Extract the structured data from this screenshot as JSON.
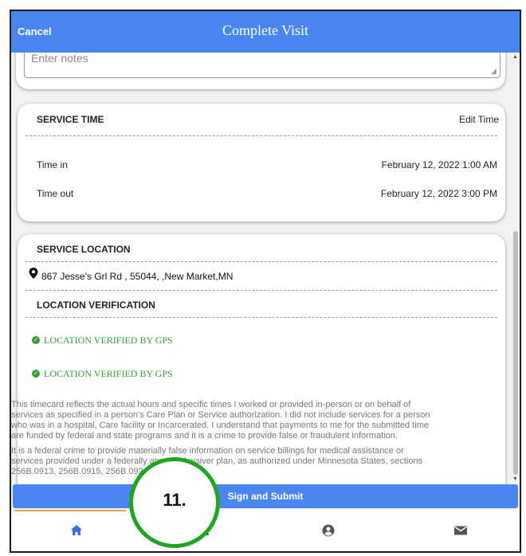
{
  "header": {
    "cancel_label": "Cancel",
    "title": "Complete Visit"
  },
  "notes": {
    "placeholder": "Enter notes"
  },
  "service_time": {
    "heading": "SERVICE TIME",
    "edit_label": "Edit Time",
    "time_in_label": "Time in",
    "time_in_value": "February 12, 2022 1:00 AM",
    "time_out_label": "Time out",
    "time_out_value": "February 12, 2022 3:00 PM"
  },
  "service_location": {
    "heading": "SERVICE LOCATION",
    "address": "867 Jesse's Grl Rd , 55044, ,New Market,MN",
    "verification_heading": "LOCATION VERIFICATION",
    "verified_1": "LOCATION VERIFIED BY GPS",
    "verified_2": "LOCATION VERIFIED BY GPS"
  },
  "legal": {
    "p1": [
      "This timecard reflects the actual hours and specific times I worked or provided in-person or on behalf of",
      "services as specified in a person's Care Plan or Service authorization. I did not include services for a person",
      "who was in a hospital, Care facility or Incarcerated. I understand that payments to me for the submitted time",
      "are funded by federal and state programs and it is a crime to provide false or fraudulent information."
    ],
    "p2": [
      "It is a federal crime to provide materially false information on service billings for medical assistance or",
      "services provided under a federally approved waiver plan, as authorized under Minnesota States, sections",
      "256B.0913, 256B.0915, 256B.092"
    ]
  },
  "submit_label": "Sign and Submit",
  "annotation_label": "11.",
  "tabs": [
    {
      "icon": "home-icon"
    },
    {
      "icon": "people-icon"
    },
    {
      "icon": "account-icon"
    },
    {
      "icon": "mail-icon"
    }
  ],
  "colors": {
    "header": "#4a86f0",
    "verified": "#3a9a3a",
    "annotation_ring": "#1fa51f",
    "tab_indicator": "#e8a040"
  }
}
